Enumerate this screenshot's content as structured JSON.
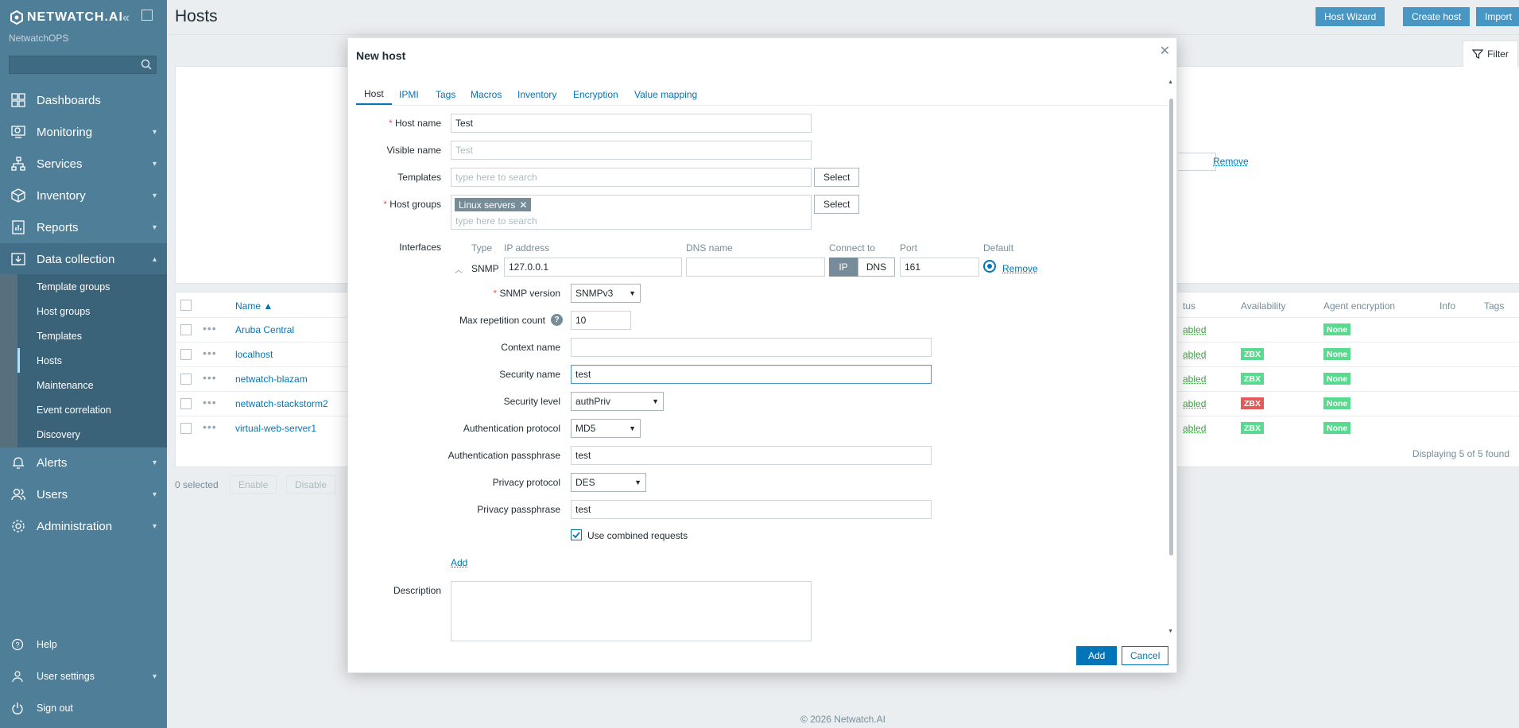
{
  "sidebar": {
    "logo": "NETWATCH.AI",
    "subtitle": "NetwatchOPS",
    "nav": [
      {
        "label": "Dashboards",
        "icon": "dashboard-icon"
      },
      {
        "label": "Monitoring",
        "icon": "monitoring-icon"
      },
      {
        "label": "Services",
        "icon": "services-icon"
      },
      {
        "label": "Inventory",
        "icon": "inventory-icon"
      },
      {
        "label": "Reports",
        "icon": "reports-icon"
      },
      {
        "label": "Data collection",
        "icon": "data-collection-icon"
      }
    ],
    "data_collection_items": [
      "Template groups",
      "Host groups",
      "Templates",
      "Hosts",
      "Maintenance",
      "Event correlation",
      "Discovery"
    ],
    "nav_after": [
      {
        "label": "Alerts",
        "icon": "bell-icon"
      },
      {
        "label": "Users",
        "icon": "users-icon"
      },
      {
        "label": "Administration",
        "icon": "gear-icon"
      }
    ],
    "bottom": [
      {
        "label": "Help",
        "icon": "help-icon"
      },
      {
        "label": "User settings",
        "icon": "user-icon"
      },
      {
        "label": "Sign out",
        "icon": "power-icon"
      }
    ]
  },
  "header": {
    "title": "Hosts",
    "buttons": [
      "Host Wizard",
      "Create host",
      "Import"
    ],
    "filter_label": "Filter"
  },
  "background": {
    "remove_label": "Remove",
    "columns": {
      "name": "Name ▲",
      "status": "tus",
      "availability": "Availability",
      "encryption": "Agent encryption",
      "info": "Info",
      "tags": "Tags"
    },
    "rows": [
      {
        "name": "Aruba Central",
        "status": "abled",
        "zbx": "",
        "zbx_state": "none",
        "enc": "None"
      },
      {
        "name": "localhost",
        "status": "abled",
        "zbx": "ZBX",
        "zbx_state": "ok",
        "enc": "None"
      },
      {
        "name": "netwatch-blazam",
        "status": "abled",
        "zbx": "ZBX",
        "zbx_state": "ok",
        "enc": "None"
      },
      {
        "name": "netwatch-stackstorm2",
        "status": "abled",
        "zbx": "ZBX",
        "zbx_state": "error",
        "enc": "None"
      },
      {
        "name": "virtual-web-server1",
        "status": "abled",
        "zbx": "ZBX",
        "zbx_state": "ok",
        "enc": "None"
      }
    ],
    "displaying": "Displaying 5 of 5 found",
    "selected": "0 selected",
    "mass_buttons": [
      "Enable",
      "Disable"
    ],
    "footer": "© 2026 Netwatch.AI"
  },
  "dialog": {
    "title": "New host",
    "tabs": [
      "Host",
      "IPMI",
      "Tags",
      "Macros",
      "Inventory",
      "Encryption",
      "Value mapping"
    ],
    "host_name_label": "Host name",
    "host_name_value": "Test",
    "visible_name_label": "Visible name",
    "visible_name_placeholder": "Test",
    "templates_label": "Templates",
    "templates_placeholder": "type here to search",
    "select_label": "Select",
    "host_groups_label": "Host groups",
    "host_group_chip": "Linux servers",
    "host_groups_placeholder": "type here to search",
    "interfaces_label": "Interfaces",
    "iface_headers": {
      "type": "Type",
      "ip": "IP address",
      "dns": "DNS name",
      "connect": "Connect to",
      "port": "Port",
      "default": "Default"
    },
    "iface": {
      "type": "SNMP",
      "ip": "127.0.0.1",
      "dns": "",
      "connect_ip": "IP",
      "connect_dns": "DNS",
      "port": "161",
      "remove": "Remove"
    },
    "snmp_version_label": "SNMP version",
    "snmp_version_value": "SNMPv3",
    "max_rep_label": "Max repetition count",
    "max_rep_value": "10",
    "context_name_label": "Context name",
    "context_name_value": "",
    "security_name_label": "Security name",
    "security_name_value": "test",
    "security_level_label": "Security level",
    "security_level_value": "authPriv",
    "auth_protocol_label": "Authentication protocol",
    "auth_protocol_value": "MD5",
    "auth_pass_label": "Authentication passphrase",
    "auth_pass_value": "test",
    "priv_protocol_label": "Privacy protocol",
    "priv_protocol_value": "DES",
    "priv_pass_label": "Privacy passphrase",
    "priv_pass_value": "test",
    "combined_label": "Use combined requests",
    "add_iface_label": "Add",
    "description_label": "Description",
    "add_button": "Add",
    "cancel_button": "Cancel"
  },
  "colors": {
    "sidebar": "#4f7f98",
    "accent": "#0275b8",
    "ok_badge": "#59db8f",
    "error_badge": "#e45959"
  }
}
